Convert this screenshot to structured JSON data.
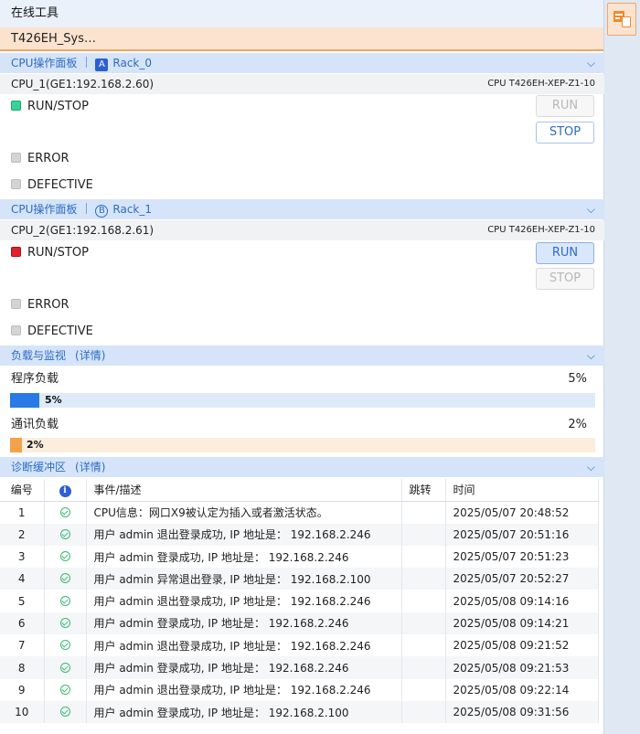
{
  "title": "在线工具",
  "device_tab": "T426EH_Sys…",
  "cpu_sections": [
    {
      "header": "CPU操作面板",
      "rack_letter": "A",
      "rack": "Rack_0",
      "cpu_name": "CPU_1(GE1:192.168.2.60)",
      "cpu_model": "CPU T426EH-XEP-Z1-10",
      "run_stop_label": "RUN/STOP",
      "run_stop_color": "#39d29a",
      "error_label": "ERROR",
      "defective_label": "DEFECTIVE",
      "run_button": "RUN",
      "stop_button": "STOP"
    },
    {
      "header": "CPU操作面板",
      "rack_letter": "B",
      "rack": "Rack_1",
      "cpu_name": "CPU_2(GE1:192.168.2.61)",
      "cpu_model": "CPU T426EH-XEP-Z1-10",
      "run_stop_label": "RUN/STOP",
      "run_stop_color": "#e0212f",
      "error_label": "ERROR",
      "defective_label": "DEFECTIVE",
      "run_button": "RUN",
      "stop_button": "STOP"
    }
  ],
  "load": {
    "header": "负载与监视",
    "details_link": "(详情)",
    "program": {
      "label": "程序负载",
      "percent_text": "5%",
      "bar_text": "5%",
      "value": 5,
      "color": "#2979e6",
      "track_color": "#dfeaf8"
    },
    "comm": {
      "label": "通讯负载",
      "percent_text": "2%",
      "bar_text": "2%",
      "value": 2,
      "color": "#f3a24a",
      "track_color": "#fbeedd"
    }
  },
  "diag": {
    "header": "诊断缓冲区",
    "details_link": "(详情)",
    "columns": {
      "no": "编号",
      "desc": "事件/描述",
      "jump": "跳转",
      "time": "时间"
    },
    "rows": [
      {
        "no": "1",
        "desc": "CPU信息：网口X9被认定为插入或者激活状态。",
        "time": "2025/05/07 20:48:52"
      },
      {
        "no": "2",
        "desc": "用户 admin 退出登录成功, IP 地址是： 192.168.2.246",
        "time": "2025/05/07 20:51:16"
      },
      {
        "no": "3",
        "desc": "用户 admin 登录成功, IP 地址是： 192.168.2.246",
        "time": "2025/05/07 20:51:23"
      },
      {
        "no": "4",
        "desc": "用户 admin 异常退出登录, IP 地址是： 192.168.2.100",
        "time": "2025/05/07 20:52:27"
      },
      {
        "no": "5",
        "desc": "用户 admin 退出登录成功, IP 地址是： 192.168.2.246",
        "time": "2025/05/08 09:14:16"
      },
      {
        "no": "6",
        "desc": "用户 admin 登录成功, IP 地址是： 192.168.2.246",
        "time": "2025/05/08 09:14:21"
      },
      {
        "no": "7",
        "desc": "用户 admin 退出登录成功, IP 地址是： 192.168.2.246",
        "time": "2025/05/08 09:21:52"
      },
      {
        "no": "8",
        "desc": "用户 admin 登录成功, IP 地址是： 192.168.2.246",
        "time": "2025/05/08 09:21:53"
      },
      {
        "no": "9",
        "desc": "用户 admin 退出登录成功, IP 地址是： 192.168.2.246",
        "time": "2025/05/08 09:22:14"
      },
      {
        "no": "10",
        "desc": "用户 admin 登录成功, IP 地址是： 192.168.2.100",
        "time": "2025/05/08 09:31:56"
      }
    ]
  },
  "icons": {
    "status_ok": "check-circle-icon",
    "info": "info-icon",
    "collapse": "chevron-down-icon",
    "rail": "online-tool-icon"
  }
}
